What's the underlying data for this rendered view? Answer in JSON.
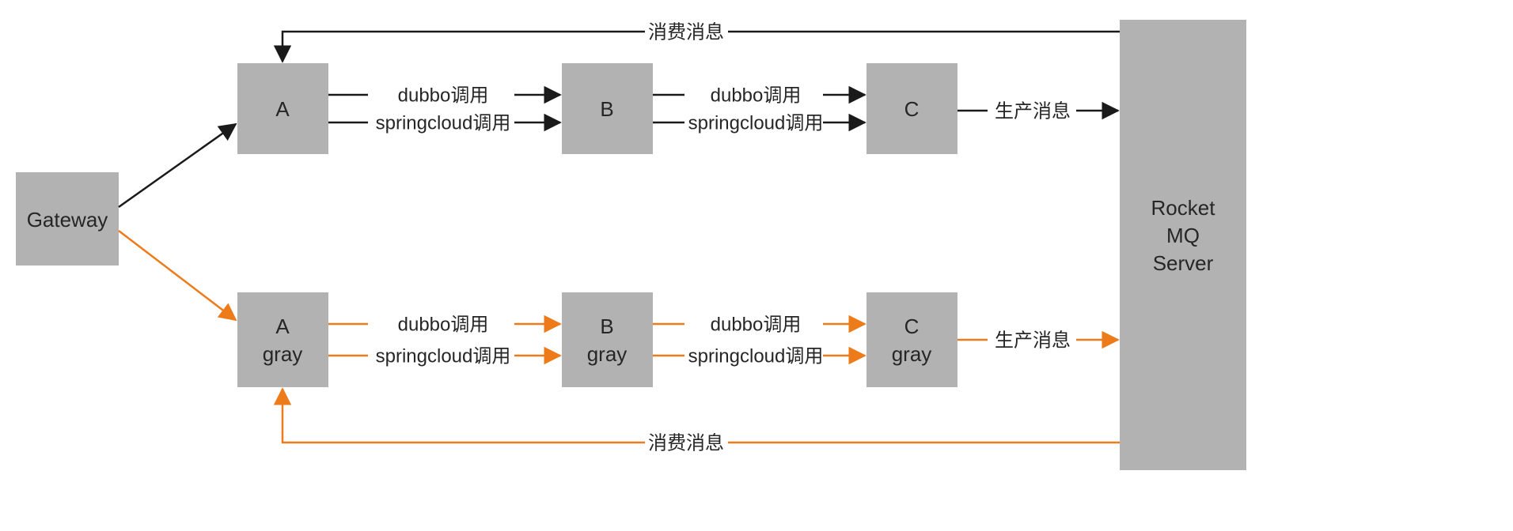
{
  "chart_data": {
    "type": "diagram",
    "nodes": [
      {
        "id": "gateway",
        "label": "Gateway"
      },
      {
        "id": "A",
        "label": "A"
      },
      {
        "id": "B",
        "label": "B"
      },
      {
        "id": "C",
        "label": "C"
      },
      {
        "id": "A_gray",
        "label": "A\ngray"
      },
      {
        "id": "B_gray",
        "label": "B\ngray"
      },
      {
        "id": "C_gray",
        "label": "C\ngray"
      },
      {
        "id": "mq",
        "label": "Rocket\nMQ\nServer"
      }
    ],
    "edges": [
      {
        "from": "gateway",
        "to": "A",
        "track": "prod"
      },
      {
        "from": "gateway",
        "to": "A_gray",
        "track": "gray"
      },
      {
        "from": "A",
        "to": "B",
        "label_top": "dubbo调用",
        "label_bottom": "springcloud调用",
        "track": "prod"
      },
      {
        "from": "B",
        "to": "C",
        "label_top": "dubbo调用",
        "label_bottom": "springcloud调用",
        "track": "prod"
      },
      {
        "from": "C",
        "to": "mq",
        "label": "生产消息",
        "track": "prod"
      },
      {
        "from": "mq",
        "to": "A",
        "label": "消费消息",
        "track": "prod"
      },
      {
        "from": "A_gray",
        "to": "B_gray",
        "label_top": "dubbo调用",
        "label_bottom": "springcloud调用",
        "track": "gray"
      },
      {
        "from": "B_gray",
        "to": "C_gray",
        "label_top": "dubbo调用",
        "label_bottom": "springcloud调用",
        "track": "gray"
      },
      {
        "from": "C_gray",
        "to": "mq",
        "label": "生产消息",
        "track": "gray"
      },
      {
        "from": "mq",
        "to": "A_gray",
        "label": "消费消息",
        "track": "gray"
      }
    ]
  },
  "colors": {
    "prod": "#1a1a1a",
    "gray": "#ee7b1a",
    "node_fill": "#b2b2b2",
    "text": "#262626"
  },
  "nodes": {
    "gateway": "Gateway",
    "A": "A",
    "B": "B",
    "C": "C",
    "A_gray_1": "A",
    "A_gray_2": "gray",
    "B_gray_1": "B",
    "B_gray_2": "gray",
    "C_gray_1": "C",
    "C_gray_2": "gray",
    "mq_1": "Rocket",
    "mq_2": "MQ",
    "mq_3": "Server"
  },
  "labels": {
    "dubbo": "dubbo调用",
    "springcloud": "springcloud调用",
    "produce": "生产消息",
    "consume": "消费消息"
  }
}
